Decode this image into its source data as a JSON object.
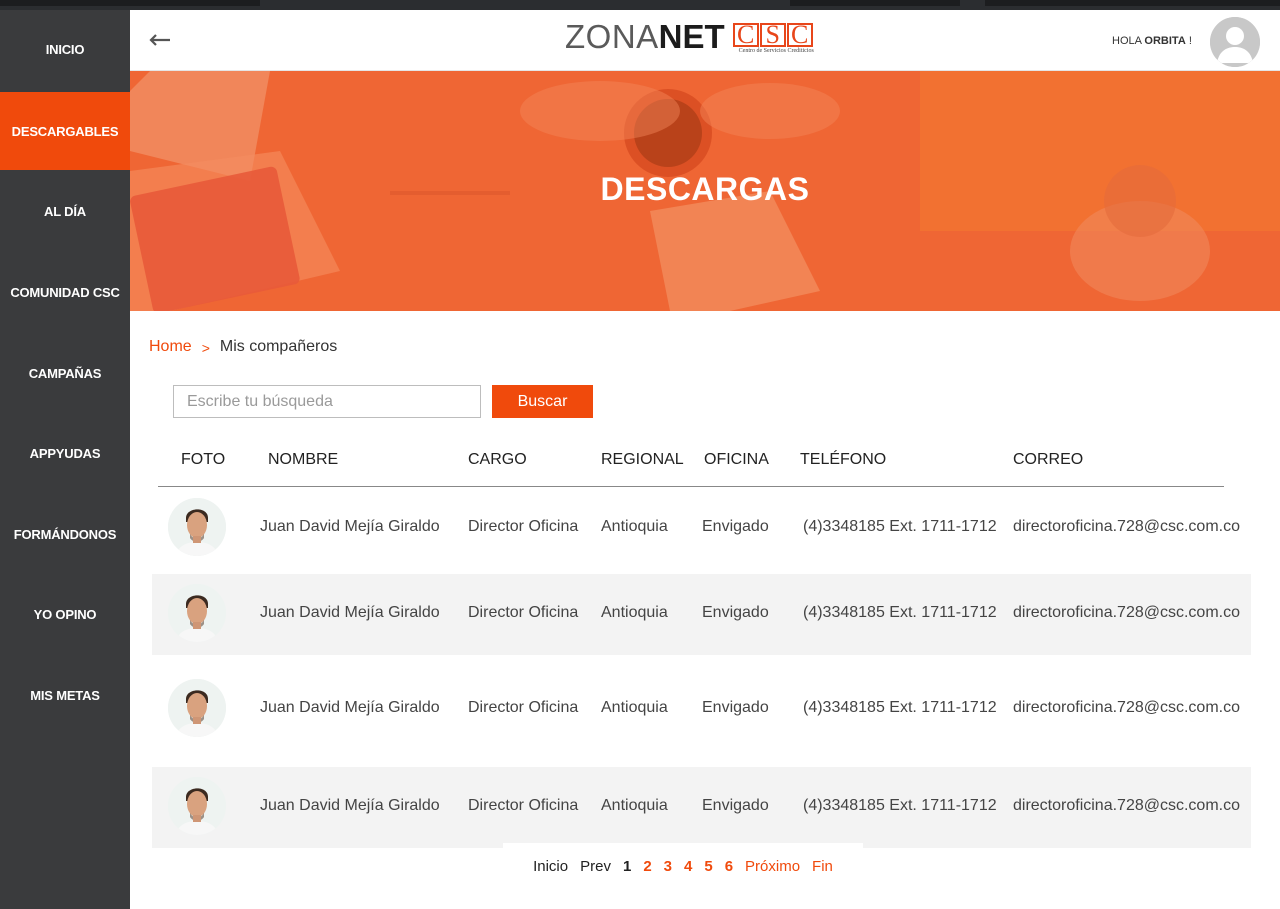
{
  "sidebar": {
    "items": [
      {
        "label": "INICIO"
      },
      {
        "label": "DESCARGABLES"
      },
      {
        "label": "AL DÍA"
      },
      {
        "label": "COMUNIDAD CSC"
      },
      {
        "label": "CAMPAÑAS"
      },
      {
        "label": "APPYUDAS"
      },
      {
        "label": "FORMÁNDONOS"
      },
      {
        "label": "YO OPINO"
      },
      {
        "label": "MIS METAS"
      }
    ],
    "active_index": 1
  },
  "header": {
    "logo_zona": "ZONA",
    "logo_net": "NET",
    "logo_csc": [
      "C",
      "S",
      "C"
    ],
    "logo_sub": "Centro de Servicios Crediticios",
    "greeting": "HOLA",
    "user": "ORBITA",
    "greeting_suffix": " !"
  },
  "banner": {
    "title": "DESCARGAS"
  },
  "breadcrumb": {
    "home": "Home",
    "separator": ">",
    "current": "Mis compañeros"
  },
  "search": {
    "placeholder": "Escribe tu búsqueda",
    "value": "",
    "button": "Buscar"
  },
  "table": {
    "headers": [
      "FOTO",
      "NOMBRE",
      "CARGO",
      "REGIONAL",
      "OFICINA",
      "TELÉFONO",
      "CORREO"
    ],
    "rows": [
      {
        "nombre": "Juan David Mejía Giraldo",
        "cargo": "Director Oficina",
        "regional": "Antioquia",
        "oficina": "Envigado",
        "telefono": "(4)3348185 Ext. 1711-1712",
        "correo": "directoroficina.728@csc.com.co"
      },
      {
        "nombre": "Juan David Mejía Giraldo",
        "cargo": "Director Oficina",
        "regional": "Antioquia",
        "oficina": "Envigado",
        "telefono": "(4)3348185 Ext. 1711-1712",
        "correo": "directoroficina.728@csc.com.co"
      },
      {
        "nombre": "Juan David Mejía Giraldo",
        "cargo": "Director Oficina",
        "regional": "Antioquia",
        "oficina": "Envigado",
        "telefono": "(4)3348185 Ext. 1711-1712",
        "correo": "directoroficina.728@csc.com.co"
      },
      {
        "nombre": "Juan David Mejía Giraldo",
        "cargo": "Director Oficina",
        "regional": "Antioquia",
        "oficina": "Envigado",
        "telefono": "(4)3348185 Ext. 1711-1712",
        "correo": "directoroficina.728@csc.com.co"
      }
    ]
  },
  "pagination": {
    "first": "Inicio",
    "prev": "Prev",
    "pages": [
      "1",
      "2",
      "3",
      "4",
      "5",
      "6"
    ],
    "current": "1",
    "next": "Próximo",
    "last": "Fin"
  },
  "colors": {
    "accent": "#f04a0c",
    "sidebar": "#3a3b3d",
    "row_alt": "#f3f3f3"
  }
}
